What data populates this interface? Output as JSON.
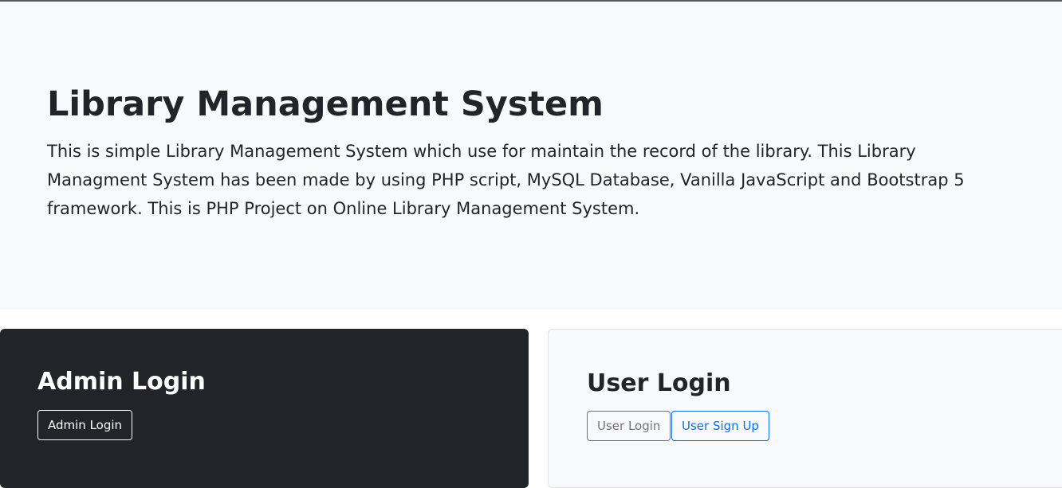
{
  "hero": {
    "title": "Library Management System",
    "description": "This is simple Library Management System which use for maintain the record of the library. This Library Managment System has been made by using PHP script, MySQL Database, Vanilla JavaScript and Bootstrap 5 framework. This is PHP Project on Online Library Management System."
  },
  "admin_card": {
    "title": "Admin Login",
    "button_label": "Admin Login"
  },
  "user_card": {
    "title": "User Login",
    "login_button_label": "User Login",
    "signup_button_label": "User Sign Up"
  },
  "colors": {
    "hero_background": "#f8f9fa",
    "admin_card_background": "#212529",
    "user_card_background": "#f8f9fa",
    "primary_outline": "#0d6efd",
    "secondary_outline": "#6c757d"
  }
}
